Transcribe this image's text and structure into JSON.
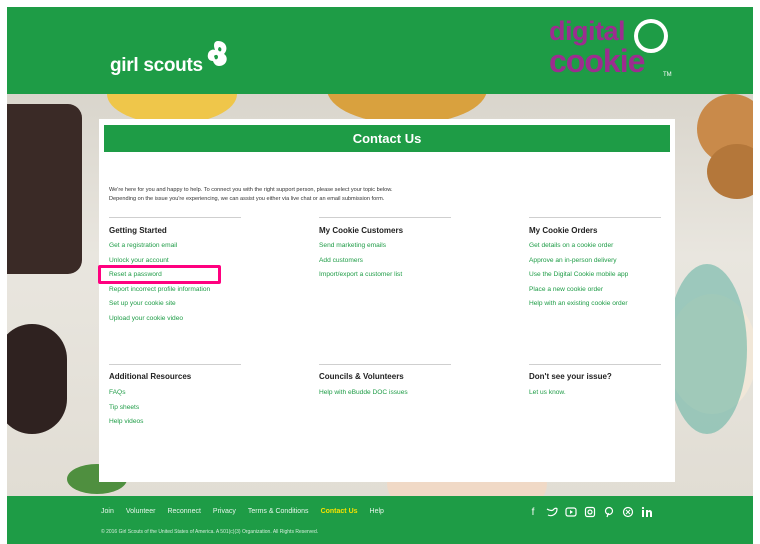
{
  "header": {
    "gs_logo_text": "girl scouts",
    "dc_logo_top": "digital",
    "dc_logo_bottom": "cookie",
    "dc_logo_tm": "TM"
  },
  "page": {
    "title": "Contact Us",
    "intro_line1": "We're here for you and happy to help. To connect you with the right support person, please select your topic below.",
    "intro_line2": "Depending on the issue you're experiencing, we can assist you either via live chat or an email submission form."
  },
  "sections": {
    "getting_started": {
      "title": "Getting Started",
      "links": [
        "Get a registration email",
        "Unlock your account",
        "Reset a password",
        "Report incorrect profile information",
        "Set up your cookie site",
        "Upload your cookie video"
      ]
    },
    "my_cookie_customers": {
      "title": "My Cookie Customers",
      "links": [
        "Send marketing emails",
        "Add customers",
        "Import/export a customer list"
      ]
    },
    "my_cookie_orders": {
      "title": "My Cookie Orders",
      "links": [
        "Get details on a cookie order",
        "Approve an in-person delivery",
        "Use the Digital Cookie mobile app",
        "Place a new cookie order",
        "Help with an existing cookie order"
      ]
    },
    "additional_resources": {
      "title": "Additional Resources",
      "links": [
        "FAQs",
        "Tip sheets",
        "Help videos"
      ]
    },
    "councils_volunteers": {
      "title": "Councils & Volunteers",
      "links": [
        "Help with eBudde DOC issues"
      ]
    },
    "dont_see_issue": {
      "title": "Don't see your issue?",
      "links": [
        "Let us know."
      ]
    }
  },
  "footer": {
    "nav": [
      "Join",
      "Volunteer",
      "Reconnect",
      "Privacy",
      "Terms & Conditions",
      "Contact Us",
      "Help"
    ],
    "active": "Contact Us",
    "copyright": "© 2016 Girl Scouts of the United States of America. A 501(c)(3) Organization. All Rights Reserved.",
    "social_icons": [
      "facebook-icon",
      "twitter-icon",
      "youtube-icon",
      "instagram-icon",
      "pinterest-icon",
      "blog-icon",
      "linkedin-icon"
    ]
  },
  "colors": {
    "brand_green": "#1e9c46",
    "digital_cookie_purple": "#9c2d8f",
    "highlight": "#ff007f",
    "footer_active": "#f4e100"
  }
}
